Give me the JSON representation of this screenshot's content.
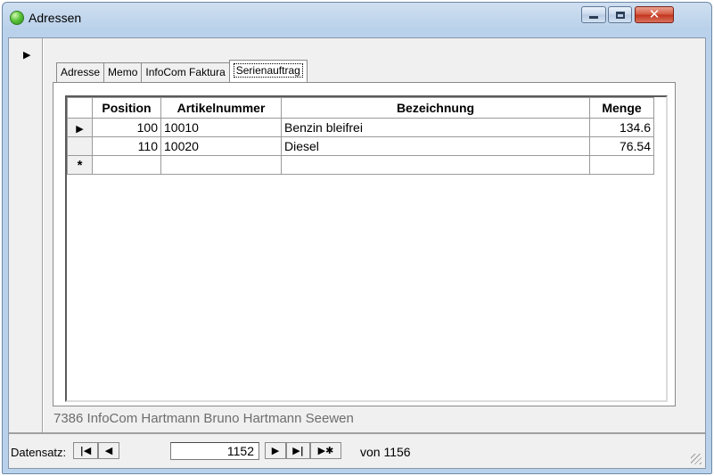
{
  "window": {
    "title": "Adressen",
    "icon": "green-circle-icon"
  },
  "tabs": [
    {
      "label": "Adresse",
      "active": false
    },
    {
      "label": "Memo",
      "active": false
    },
    {
      "label": "InfoCom Faktura",
      "active": false
    },
    {
      "label": "Serienauftrag",
      "active": true
    }
  ],
  "grid": {
    "columns": [
      "Position",
      "Artikelnummer",
      "Bezeichnung",
      "Menge"
    ],
    "rows": [
      {
        "position": "100",
        "artikelnummer": "10010",
        "bezeichnung": "Benzin bleifrei",
        "menge": "134.6"
      },
      {
        "position": "110",
        "artikelnummer": "10020",
        "bezeichnung": "Diesel",
        "menge": "76.54"
      }
    ],
    "new_row_marker": "*"
  },
  "footer": {
    "record_info": "7386 InfoCom Hartmann Bruno Hartmann Seewen"
  },
  "navigation": {
    "label": "Datensatz:",
    "current_record": "1152",
    "of_label": "von",
    "total_records": "1156"
  },
  "colors": {
    "titlebar": "#b9d1ea",
    "close_button": "#c1321c",
    "form_background": "#f0f0f0"
  }
}
